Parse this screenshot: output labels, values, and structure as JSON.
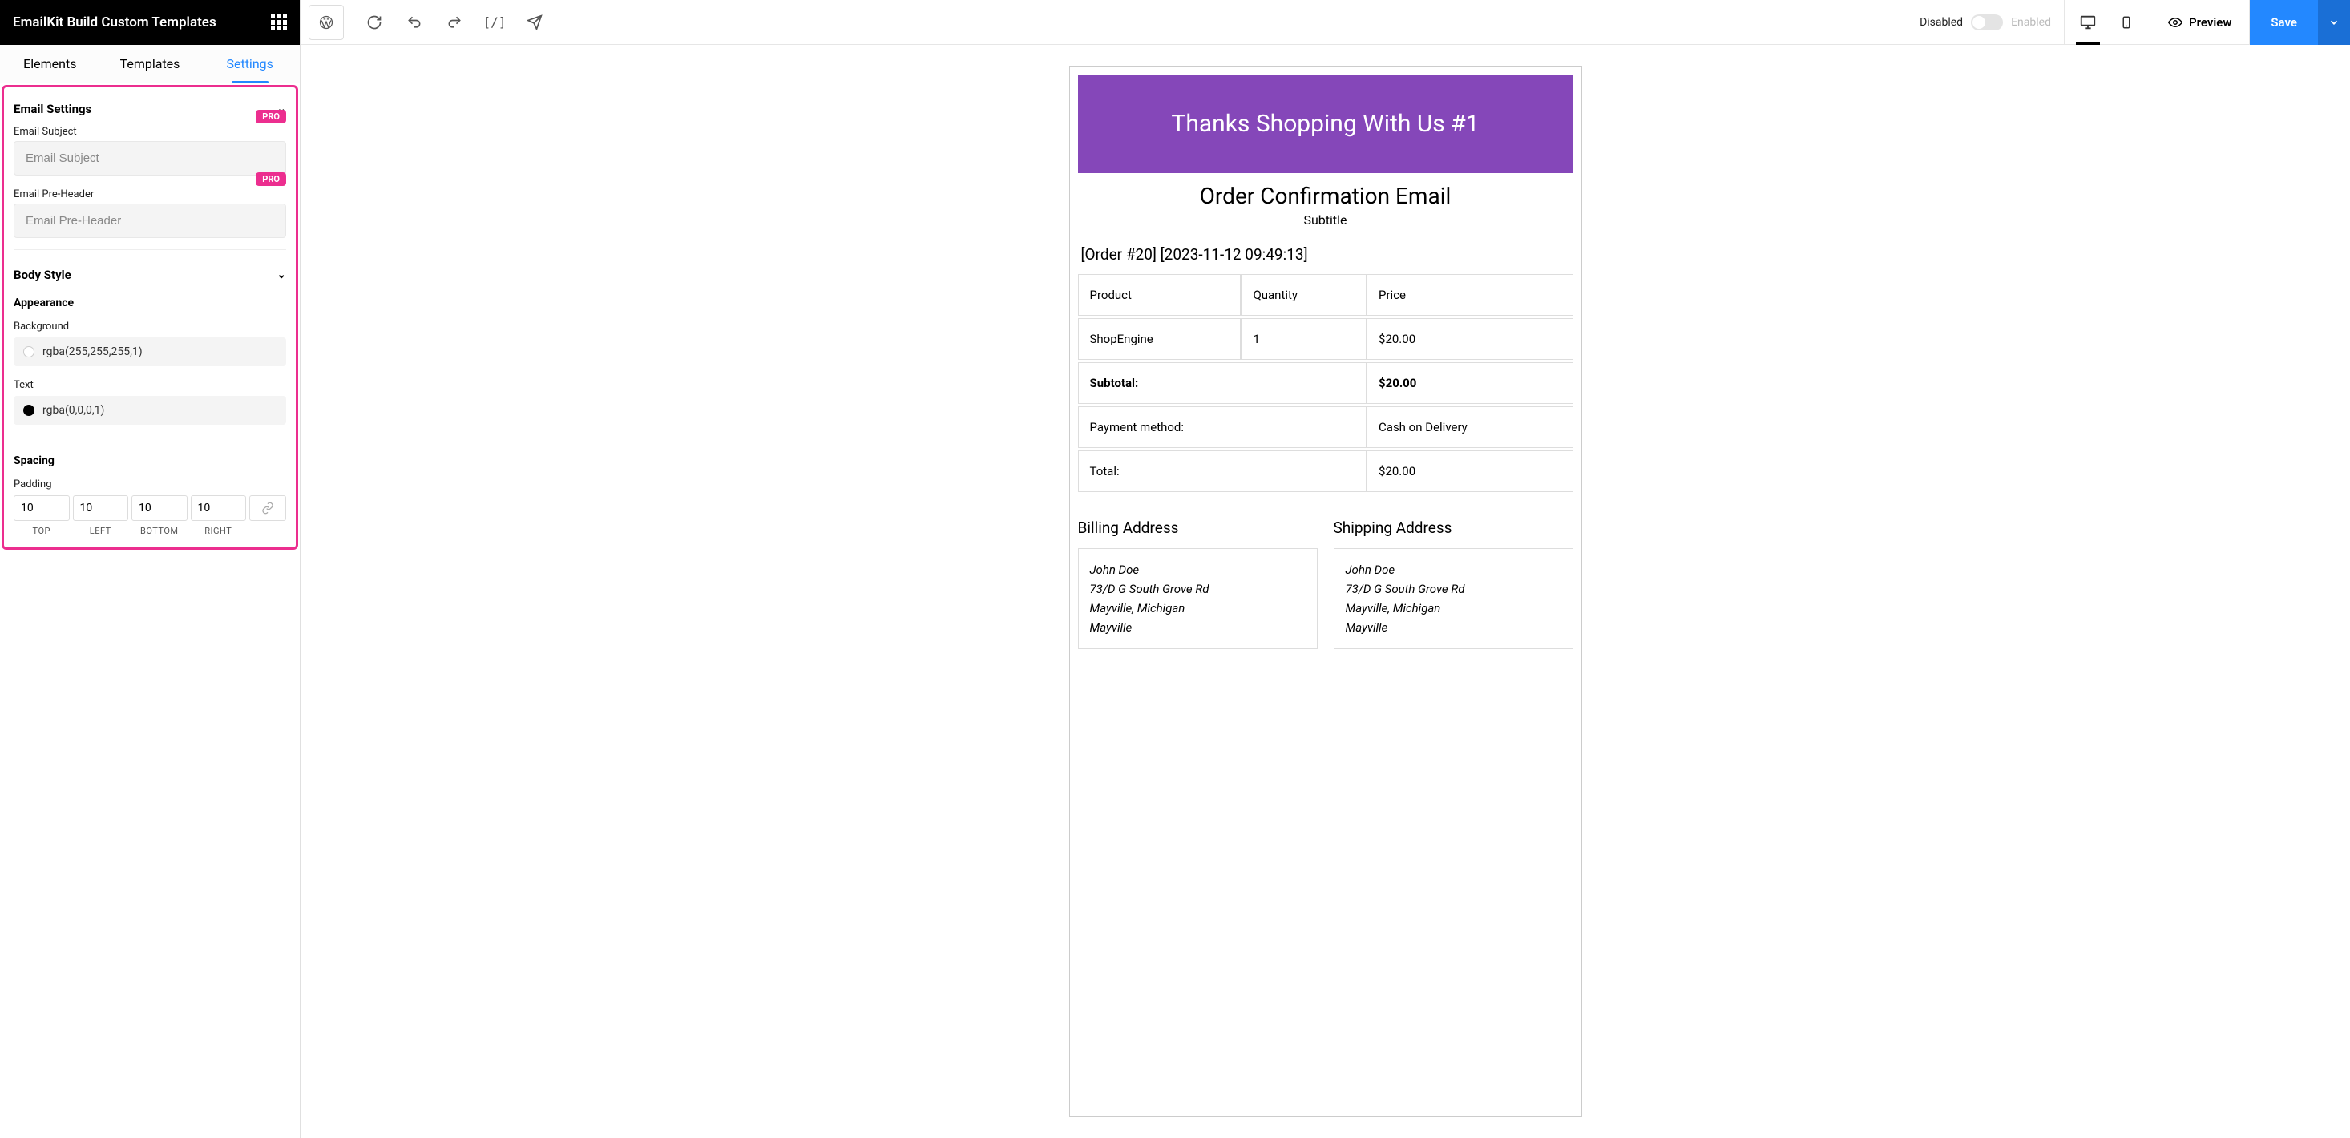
{
  "header": {
    "title": "EmailKit Build Custom Templates"
  },
  "tabs": {
    "elements": "Elements",
    "templates": "Templates",
    "settings": "Settings"
  },
  "settings": {
    "email_settings_title": "Email Settings",
    "subject_label": "Email Subject",
    "subject_placeholder": "Email Subject",
    "preheader_label": "Email Pre-Header",
    "preheader_placeholder": "Email Pre-Header",
    "pro_badge": "PRO",
    "body_style_title": "Body Style",
    "appearance_title": "Appearance",
    "background_label": "Background",
    "background_value": "rgba(255,255,255,1)",
    "text_label": "Text",
    "text_value": "rgba(0,0,0,1)",
    "spacing_title": "Spacing",
    "padding_label": "Padding",
    "padding": {
      "top": "10",
      "left": "10",
      "bottom": "10",
      "right": "10"
    },
    "padding_labels": {
      "top": "TOP",
      "left": "LEFT",
      "bottom": "BOTTOM",
      "right": "RIGHT"
    }
  },
  "toolbar": {
    "disabled": "Disabled",
    "enabled": "Enabled",
    "preview": "Preview",
    "save": "Save"
  },
  "email": {
    "banner": "Thanks Shopping With Us #1",
    "title": "Order Confirmation Email",
    "subtitle": "Subtitle",
    "order_line": "[Order #20] [2023-11-12 09:49:13]",
    "headers": {
      "product": "Product",
      "quantity": "Quantity",
      "price": "Price"
    },
    "item": {
      "name": "ShopEngine",
      "qty": "1",
      "price": "$20.00"
    },
    "subtotal_label": "Subtotal:",
    "subtotal_value": "$20.00",
    "payment_label": "Payment method:",
    "payment_value": "Cash on Delivery",
    "total_label": "Total:",
    "total_value": "$20.00",
    "billing_title": "Billing Address",
    "shipping_title": "Shipping Address",
    "address": {
      "name": "John Doe",
      "street": "73/D G South Grove Rd",
      "city_state": "Mayville, Michigan",
      "city": "Mayville"
    }
  }
}
